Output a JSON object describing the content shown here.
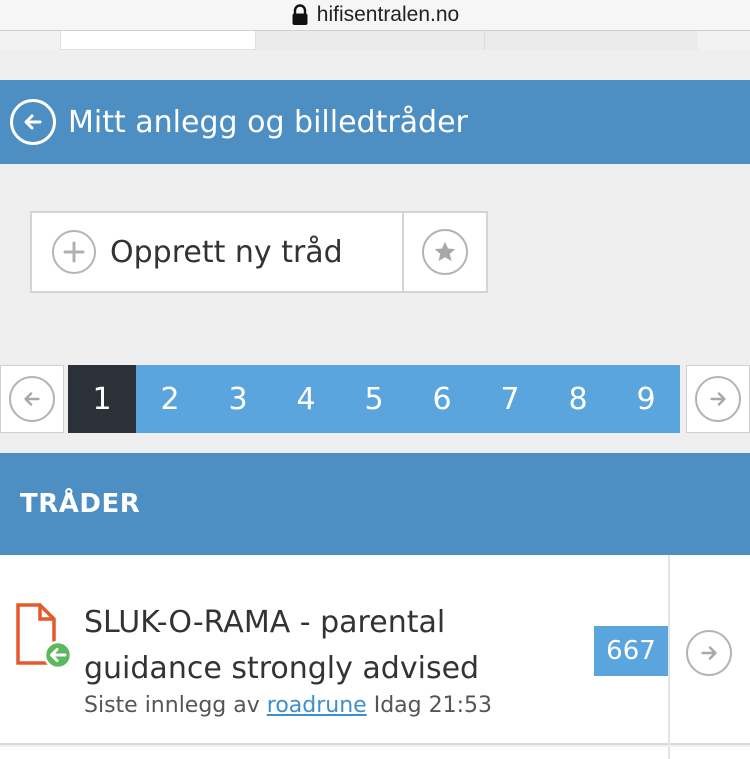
{
  "browser": {
    "url": "hifisentralen.no"
  },
  "category": {
    "title": "Mitt anlegg og billedtråder"
  },
  "actions": {
    "new_thread_label": "Opprett ny tråd"
  },
  "pagination": {
    "pages": [
      "1",
      "2",
      "3",
      "4",
      "5",
      "6",
      "7",
      "8",
      "9"
    ],
    "current": "1"
  },
  "threads": {
    "header": "TRÅDER",
    "items": [
      {
        "title": "SLUK-O-RAMA - parental guidance strongly advised",
        "meta_prefix": "Siste innlegg av",
        "user": "roadrune",
        "time": "Idag 21:53",
        "replies": "667"
      }
    ]
  },
  "colors": {
    "header_blue": "#4d8fc2",
    "page_blue": "#5aa5dd",
    "active_page": "#2b3138",
    "link": "#3d8fd0",
    "doc_icon": "#e45a2c",
    "unread_green": "#5cb85c"
  }
}
